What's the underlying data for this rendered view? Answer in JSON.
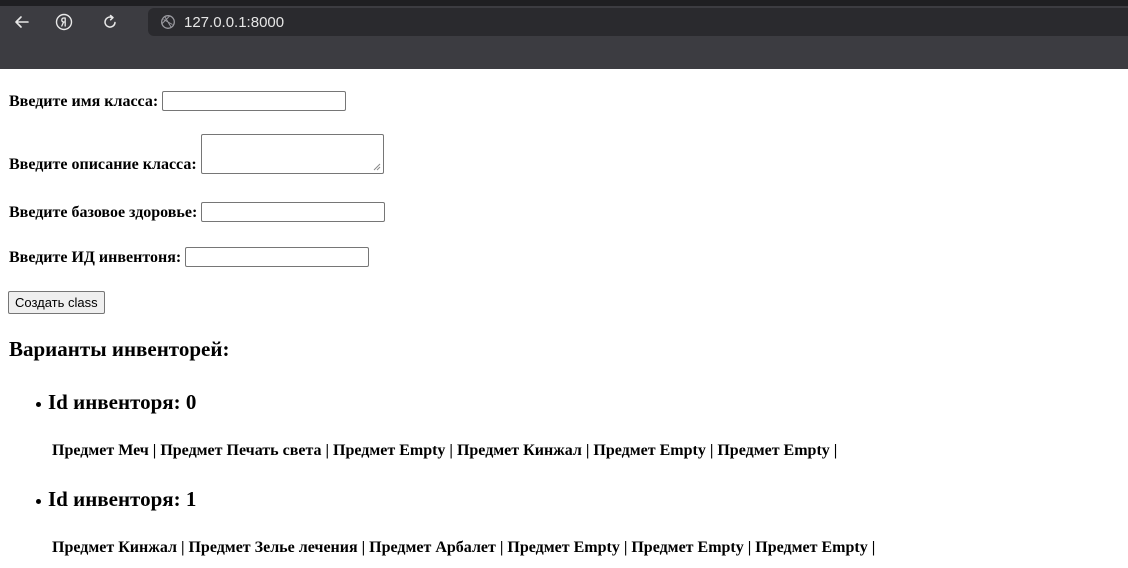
{
  "browser": {
    "url": "127.0.0.1:8000",
    "icons": {
      "back": "arrow-left-icon",
      "yandex": "yandex-logo-icon",
      "reload": "reload-icon",
      "site": "site-info-icon"
    }
  },
  "form": {
    "class_name_label": "Введите имя класса:",
    "class_name_value": "",
    "class_description_label": "Введите описание класса:",
    "class_description_value": "",
    "base_health_label": "Введите базовое здоровье:",
    "base_health_value": "",
    "inventory_id_label": "Введите ИД инвентоня:",
    "inventory_id_value": "",
    "submit_label": "Создать class"
  },
  "inventories": {
    "title": "Варианты инвенторей:",
    "items": [
      {
        "heading": "Id инвентоpя: 0",
        "contents": "Предмет Меч | Предмет Печать света | Предмет Empty | Предмет Кинжал | Предмет Empty | Предмет Empty |"
      },
      {
        "heading": "Id инвентоpя: 1",
        "contents": "Предмет Кинжал | Предмет Зелье лечения | Предмет Арбалет | Предмет Empty | Предмет Empty | Предмет Empty |"
      }
    ]
  },
  "colors": {
    "toolbar": "#3c3c41",
    "address_bar": "#2a2a2e",
    "button_bg": "#efefef"
  }
}
